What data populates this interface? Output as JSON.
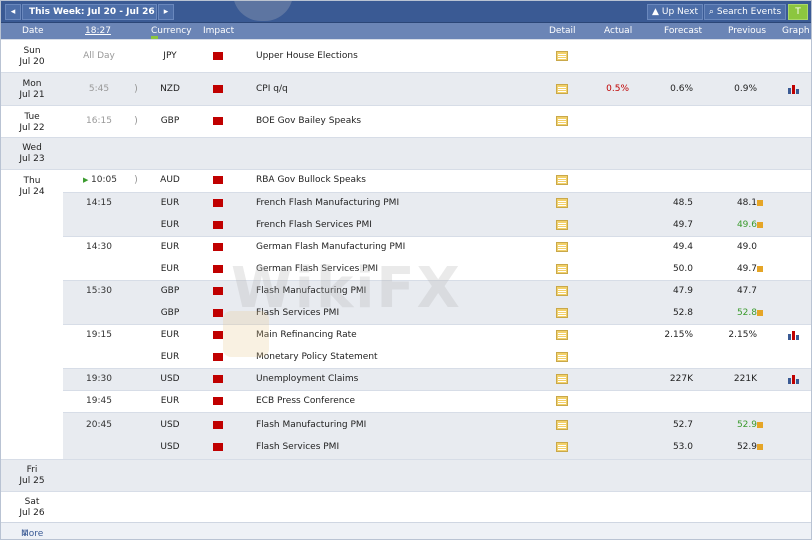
{
  "toolbar": {
    "prev_icon": "◂",
    "week_label": "This Week: Jul 20 - Jul 26",
    "next_icon": "▸",
    "up_next_label": "Up Next",
    "search_label": "Search Events",
    "filter_icon": "T"
  },
  "header": {
    "date": "Date",
    "time": "18:27",
    "currency": "Currency",
    "impact": "Impact",
    "detail": "Detail",
    "actual": "Actual",
    "forecast": "Forecast",
    "previous": "Previous",
    "graph": "Graph"
  },
  "days": [
    {
      "day": "Sun",
      "date": "Jul 20"
    },
    {
      "day": "Mon",
      "date": "Jul 21"
    },
    {
      "day": "Tue",
      "date": "Jul 22"
    },
    {
      "day": "Wed",
      "date": "Jul 23"
    },
    {
      "day": "Thu",
      "date": "Jul 24"
    },
    {
      "day": "Fri",
      "date": "Jul 25"
    },
    {
      "day": "Sat",
      "date": "Jul 26"
    }
  ],
  "events": [
    {
      "time": "All Day",
      "currency": "JPY",
      "event": "Upper House Elections",
      "actual": "",
      "forecast": "",
      "previous": ""
    },
    {
      "time": "5:45",
      "currency": "NZD",
      "event": "CPI q/q",
      "actual": "0.5%",
      "forecast": "0.6%",
      "previous": "0.9%"
    },
    {
      "time": "16:15",
      "currency": "GBP",
      "event": "BOE Gov Bailey Speaks",
      "actual": "",
      "forecast": "",
      "previous": ""
    },
    {
      "time": "10:05",
      "currency": "AUD",
      "event": "RBA Gov Bullock Speaks",
      "actual": "",
      "forecast": "",
      "previous": ""
    },
    {
      "time": "14:15",
      "currency": "EUR",
      "event": "French Flash Manufacturing PMI",
      "actual": "",
      "forecast": "48.5",
      "previous": "48.1"
    },
    {
      "time": "",
      "currency": "EUR",
      "event": "French Flash Services PMI",
      "actual": "",
      "forecast": "49.7",
      "previous": "49.6"
    },
    {
      "time": "14:30",
      "currency": "EUR",
      "event": "German Flash Manufacturing PMI",
      "actual": "",
      "forecast": "49.4",
      "previous": "49.0"
    },
    {
      "time": "",
      "currency": "EUR",
      "event": "German Flash Services PMI",
      "actual": "",
      "forecast": "50.0",
      "previous": "49.7"
    },
    {
      "time": "15:30",
      "currency": "GBP",
      "event": "Flash Manufacturing PMI",
      "actual": "",
      "forecast": "47.9",
      "previous": "47.7"
    },
    {
      "time": "",
      "currency": "GBP",
      "event": "Flash Services PMI",
      "actual": "",
      "forecast": "52.8",
      "previous": "52.8"
    },
    {
      "time": "19:15",
      "currency": "EUR",
      "event": "Main Refinancing Rate",
      "actual": "",
      "forecast": "2.15%",
      "previous": "2.15%"
    },
    {
      "time": "",
      "currency": "EUR",
      "event": "Monetary Policy Statement",
      "actual": "",
      "forecast": "",
      "previous": ""
    },
    {
      "time": "19:30",
      "currency": "USD",
      "event": "Unemployment Claims",
      "actual": "",
      "forecast": "227K",
      "previous": "221K"
    },
    {
      "time": "19:45",
      "currency": "EUR",
      "event": "ECB Press Conference",
      "actual": "",
      "forecast": "",
      "previous": ""
    },
    {
      "time": "20:45",
      "currency": "USD",
      "event": "Flash Manufacturing PMI",
      "actual": "",
      "forecast": "52.7",
      "previous": "52.9"
    },
    {
      "time": "",
      "currency": "USD",
      "event": "Flash Services PMI",
      "actual": "",
      "forecast": "53.0",
      "previous": "52.9"
    }
  ],
  "footer": {
    "more_label": "More",
    "more_icon": "⇓"
  },
  "watermark": "WikiFX",
  "colors": {
    "accent": "#3a5a94",
    "impact_high": "#c00000",
    "actual": "#c00000",
    "revised_up": "#3b9b2e",
    "filter": "#8cc63f"
  }
}
